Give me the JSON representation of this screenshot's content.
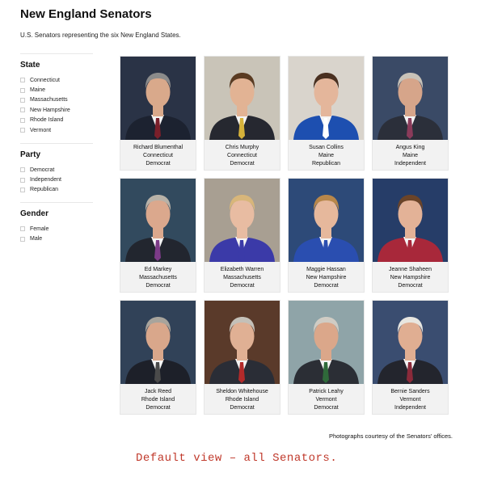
{
  "page": {
    "title": "New England Senators",
    "subtitle": "U.S. Senators representing the six New England States.",
    "credit": "Photographs courtesy of the Senators' offices.",
    "caption": "Default view – all Senators."
  },
  "filters": {
    "state": {
      "heading": "State",
      "options": [
        "Connecticut",
        "Maine",
        "Massachusetts",
        "New Hampshire",
        "Rhode Island",
        "Vermont"
      ]
    },
    "party": {
      "heading": "Party",
      "options": [
        "Democrat",
        "Independent",
        "Republican"
      ]
    },
    "gender": {
      "heading": "Gender",
      "options": [
        "Female",
        "Male"
      ]
    }
  },
  "senators": [
    {
      "name": "Richard Blumenthal",
      "state": "Connecticut",
      "party": "Democrat",
      "bg": "#2a3346",
      "suit": "#1c2230",
      "tie": "#7a1f2a",
      "hair": "#8b8b8b",
      "skin": "#d9a98b"
    },
    {
      "name": "Chris Murphy",
      "state": "Connecticut",
      "party": "Democrat",
      "bg": "#c9c4b8",
      "suit": "#262830",
      "tie": "#d6b23a",
      "hair": "#5a3b22",
      "skin": "#e2b394"
    },
    {
      "name": "Susan Collins",
      "state": "Maine",
      "party": "Republican",
      "bg": "#d9d4cc",
      "suit": "#1d4fb0",
      "tie": "#ffffff",
      "hair": "#4a3020",
      "skin": "#e4b69b"
    },
    {
      "name": "Angus King",
      "state": "Maine",
      "party": "Independent",
      "bg": "#3a4a66",
      "suit": "#2b2f3a",
      "tie": "#8a3b5a",
      "hair": "#c8c2b8",
      "skin": "#d6a58a"
    },
    {
      "name": "Ed Markey",
      "state": "Massachusetts",
      "party": "Democrat",
      "bg": "#324a5e",
      "suit": "#22262f",
      "tie": "#7c3b88",
      "hair": "#b8b2a8",
      "skin": "#dba88d"
    },
    {
      "name": "Elizabeth Warren",
      "state": "Massachusetts",
      "party": "Democrat",
      "bg": "#a89f92",
      "suit": "#3b3aa8",
      "tie": "#3b3aa8",
      "hair": "#d8b67a",
      "skin": "#e8bca2"
    },
    {
      "name": "Maggie Hassan",
      "state": "New Hampshire",
      "party": "Democrat",
      "bg": "#2d4a78",
      "suit": "#2a4eb0",
      "tie": "#2a4eb0",
      "hair": "#b8874a",
      "skin": "#e6b89c"
    },
    {
      "name": "Jeanne Shaheen",
      "state": "New Hampshire",
      "party": "Democrat",
      "bg": "#263d68",
      "suit": "#a8283a",
      "tie": "#a8283a",
      "hair": "#6b4428",
      "skin": "#e3b297"
    },
    {
      "name": "Jack Reed",
      "state": "Rhode Island",
      "party": "Democrat",
      "bg": "#314258",
      "suit": "#1d2029",
      "tie": "#4a4a4a",
      "hair": "#a8a49c",
      "skin": "#d9a78b"
    },
    {
      "name": "Sheldon Whitehouse",
      "state": "Rhode Island",
      "party": "Democrat",
      "bg": "#5a3a2a",
      "suit": "#2a2d36",
      "tie": "#b32a2a",
      "hair": "#c4c0b8",
      "skin": "#e0b094"
    },
    {
      "name": "Patrick Leahy",
      "state": "Vermont",
      "party": "Democrat",
      "bg": "#8fa4a8",
      "suit": "#2b2e35",
      "tie": "#2f6a3a",
      "hair": "#d0ccc4",
      "skin": "#dba78a"
    },
    {
      "name": "Bernie Sanders",
      "state": "Vermont",
      "party": "Independent",
      "bg": "#3a4d70",
      "suit": "#23252d",
      "tie": "#8a2a3a",
      "hair": "#e8e6e0",
      "skin": "#e0ae92"
    }
  ]
}
